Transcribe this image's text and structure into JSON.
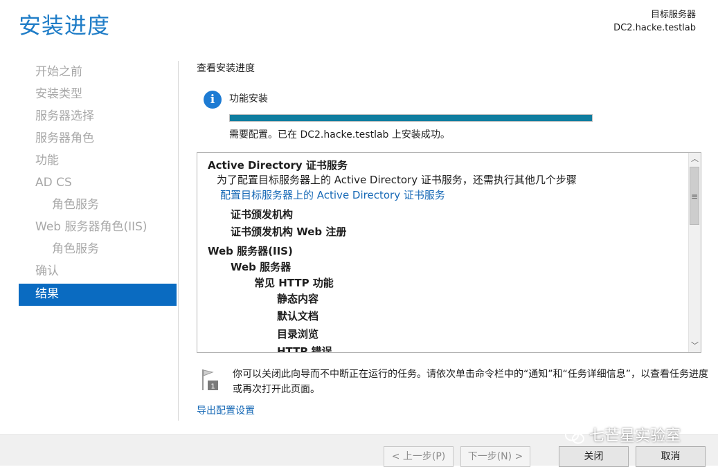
{
  "header": {
    "title": "安装进度",
    "target_label": "目标服务器",
    "target_server": "DC2.hacke.testlab"
  },
  "nav": {
    "items": [
      {
        "label": "开始之前",
        "sub": false,
        "active": false
      },
      {
        "label": "安装类型",
        "sub": false,
        "active": false
      },
      {
        "label": "服务器选择",
        "sub": false,
        "active": false
      },
      {
        "label": "服务器角色",
        "sub": false,
        "active": false
      },
      {
        "label": "功能",
        "sub": false,
        "active": false
      },
      {
        "label": "AD CS",
        "sub": false,
        "active": false
      },
      {
        "label": "角色服务",
        "sub": true,
        "active": false
      },
      {
        "label": "Web 服务器角色(IIS)",
        "sub": false,
        "active": false
      },
      {
        "label": "角色服务",
        "sub": true,
        "active": false
      },
      {
        "label": "确认",
        "sub": false,
        "active": false
      },
      {
        "label": "结果",
        "sub": false,
        "active": true
      }
    ]
  },
  "main": {
    "view_title": "查看安装进度",
    "feature_label": "功能安装",
    "progress": 1.0,
    "status_text": "需要配置。已在 DC2.hacke.testlab 上安装成功。",
    "results": [
      {
        "text": "Active Directory 证书服务",
        "indent": 0,
        "bold": true,
        "link": false
      },
      {
        "text": "为了配置目标服务器上的 Active Directory 证书服务，还需执行其他几个步骤",
        "indent": 1,
        "bold": false,
        "link": false
      },
      {
        "text": "配置目标服务器上的 Active Directory 证书服务",
        "indent": 1.5,
        "bold": false,
        "link": true
      },
      {
        "text": "证书颁发机构",
        "indent": 2,
        "bold": true,
        "link": false
      },
      {
        "text": "证书颁发机构 Web 注册",
        "indent": 2,
        "bold": true,
        "link": false
      },
      {
        "text": "Web 服务器(IIS)",
        "indent": 0,
        "bold": true,
        "link": false
      },
      {
        "text": "Web 服务器",
        "indent": 2,
        "bold": true,
        "link": false
      },
      {
        "text": "常见 HTTP 功能",
        "indent": 3,
        "bold": true,
        "link": false
      },
      {
        "text": "静态内容",
        "indent": 4,
        "bold": true,
        "link": false
      },
      {
        "text": "默认文档",
        "indent": 4,
        "bold": true,
        "link": false
      },
      {
        "text": "目录浏览",
        "indent": 4,
        "bold": true,
        "link": false
      },
      {
        "text": "HTTP 错误",
        "indent": 4,
        "bold": true,
        "link": false
      }
    ],
    "note": "你可以关闭此向导而不中断正在运行的任务。请依次单击命令栏中的“通知”和“任务详细信息”，以查看任务进度或再次打开此页面。",
    "export_link": "导出配置设置"
  },
  "footer": {
    "prev": "< 上一步(P)",
    "next": "下一步(N) >",
    "close": "关闭",
    "cancel": "取消"
  },
  "watermark": "七芒星实验室",
  "colors": {
    "accent": "#1e7cc7",
    "nav_active_bg": "#0a6bc1",
    "progress_fill": "#0f7d9f",
    "link": "#1769b6",
    "info_icon": "#1d7bd3"
  }
}
